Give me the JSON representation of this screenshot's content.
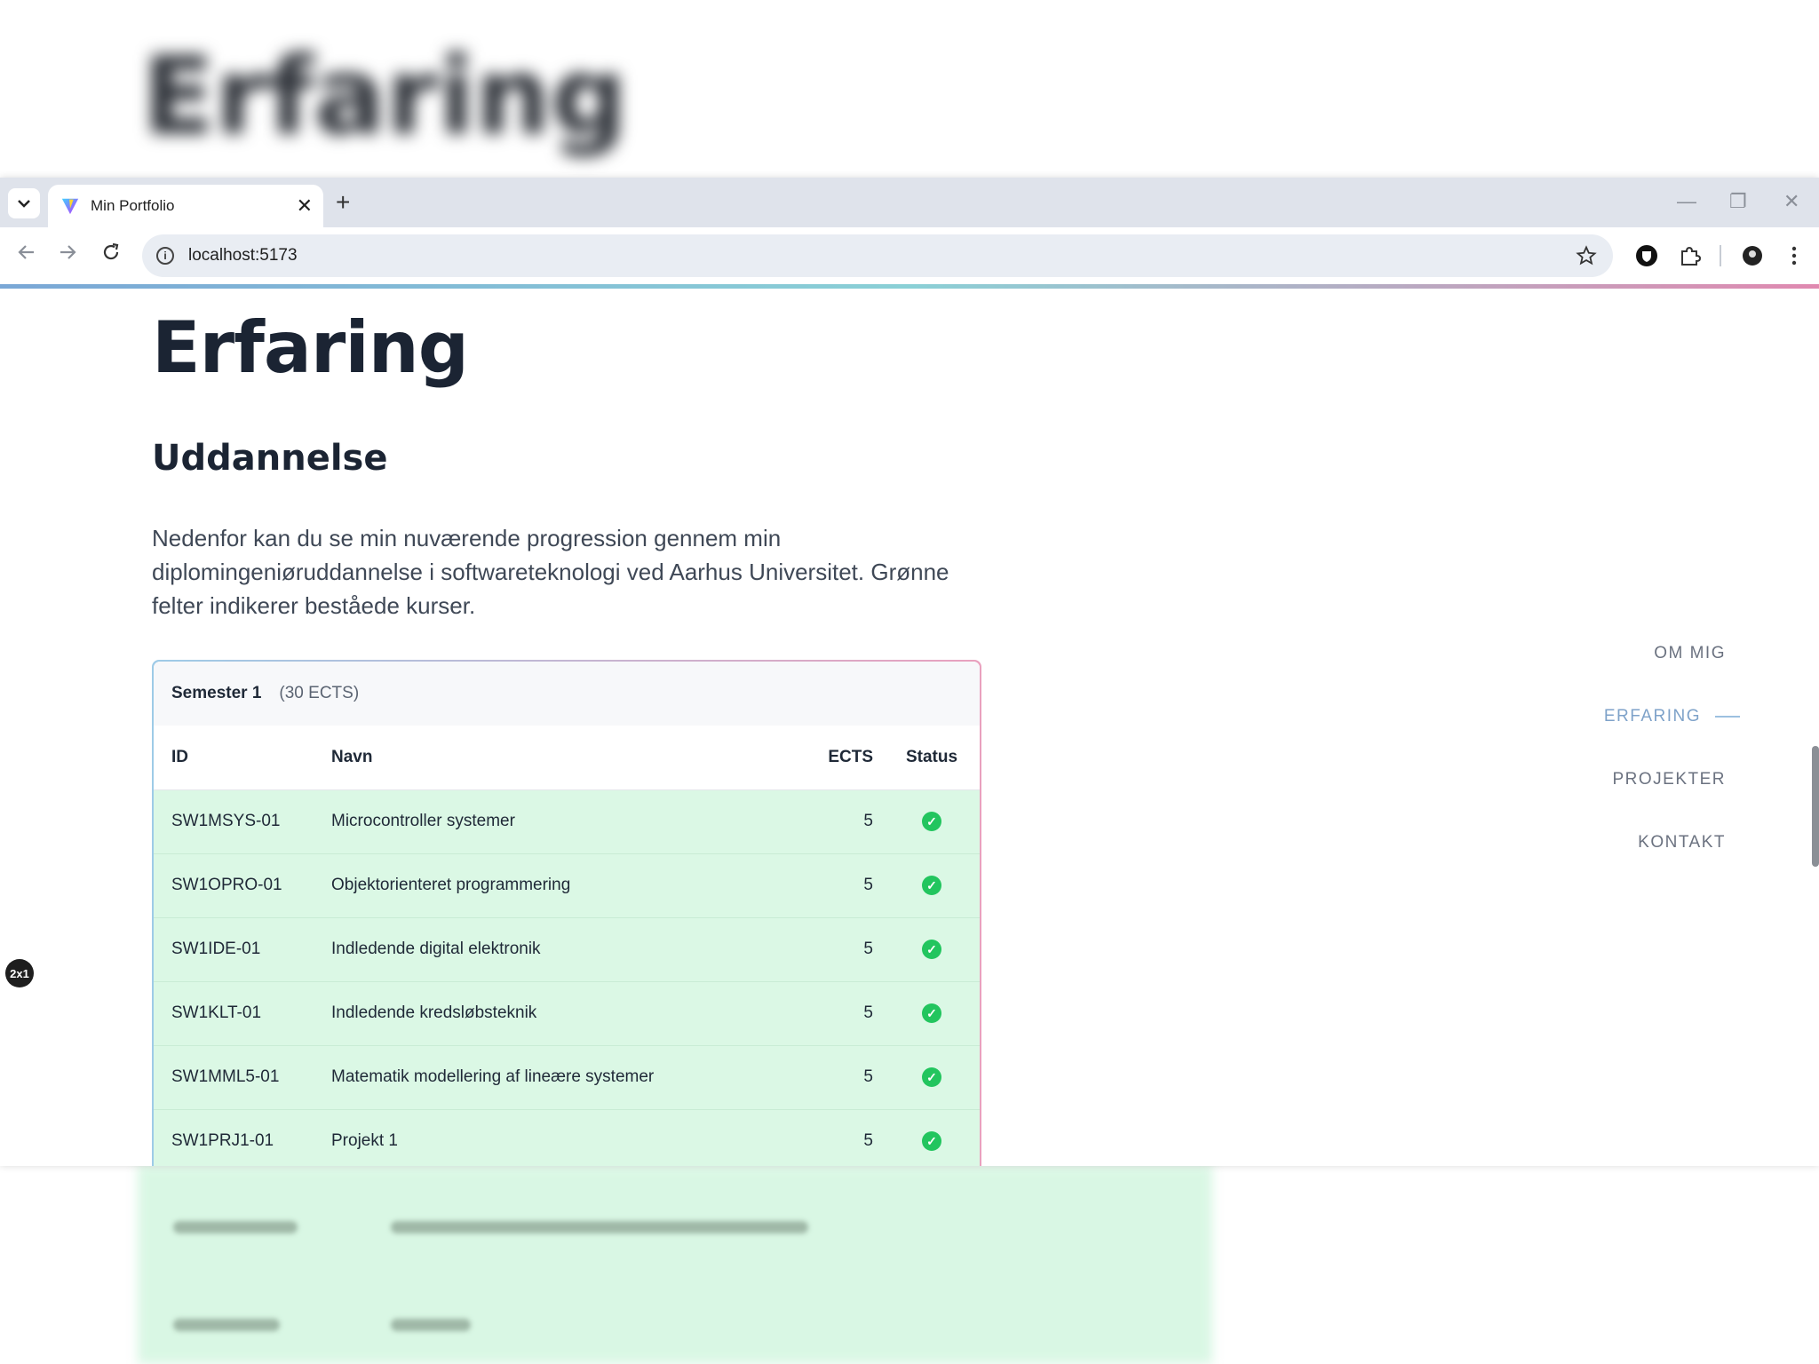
{
  "background": {
    "blurred_title": "Erfaring"
  },
  "browser": {
    "tab_title": "Min Portfolio",
    "new_tab_symbol": "+",
    "close_tab_symbol": "✕",
    "url": "localhost:5173",
    "window_controls": {
      "minimize": "—",
      "restore": "❐",
      "close": "✕"
    }
  },
  "page": {
    "title": "Erfaring",
    "section_title": "Uddannelse",
    "intro": "Nedenfor kan du se min nuværende progression gennem min diplomingeniøruddannelse i softwareteknologi ved Aarhus Universitet. Grønne felter indikerer beståede kurser.",
    "semester": {
      "name": "Semester 1",
      "ects_label": "(30 ECTS)",
      "columns": {
        "id": "ID",
        "name": "Navn",
        "ects": "ECTS",
        "status": "Status"
      },
      "rows": [
        {
          "id": "SW1MSYS-01",
          "name": "Microcontroller systemer",
          "ects": "5",
          "status": "passed"
        },
        {
          "id": "SW1OPRO-01",
          "name": "Objektorienteret programmering",
          "ects": "5",
          "status": "passed"
        },
        {
          "id": "SW1IDE-01",
          "name": "Indledende digital elektronik",
          "ects": "5",
          "status": "passed"
        },
        {
          "id": "SW1KLT-01",
          "name": "Indledende kredsløbsteknik",
          "ects": "5",
          "status": "passed"
        },
        {
          "id": "SW1MML5-01",
          "name": "Matematik modellering af lineære systemer",
          "ects": "5",
          "status": "passed"
        },
        {
          "id": "SW1PRJ1-01",
          "name": "Projekt 1",
          "ects": "5",
          "status": "passed"
        }
      ]
    },
    "sidenav": {
      "om_mig": "OM MIG",
      "erfaring": "ERFARING",
      "projekter": "PROJEKTER",
      "kontakt": "KONTAKT"
    }
  },
  "overlay_badge": "2x1",
  "colors": {
    "passed_row": "#dbf8e5",
    "check": "#22c55e",
    "active_nav": "#7ea2c9"
  }
}
